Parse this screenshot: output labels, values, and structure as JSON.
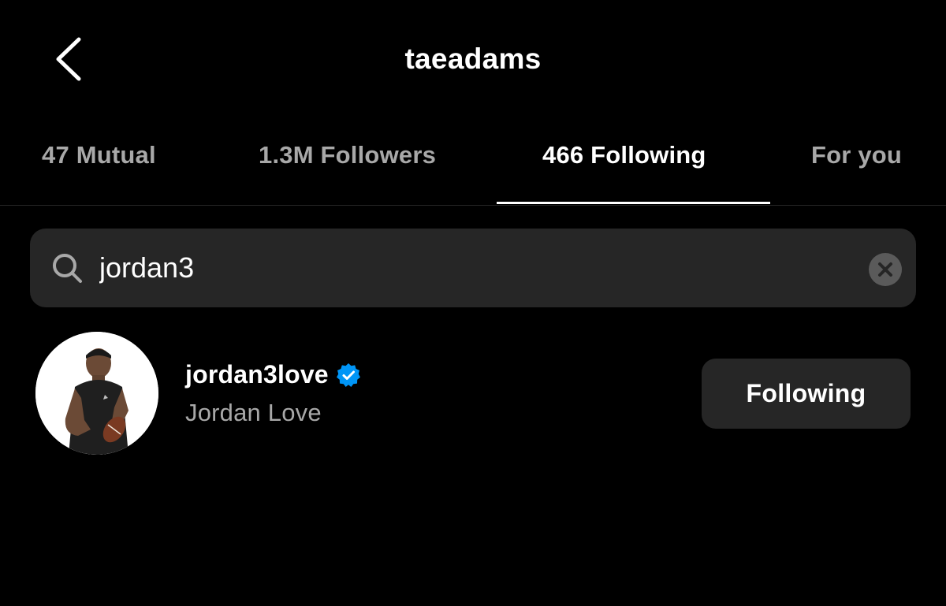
{
  "header": {
    "title": "taeadams",
    "back_icon": "chevron-left-icon"
  },
  "tabs": [
    {
      "label": "47 Mutual",
      "active": false
    },
    {
      "label": "1.3M Followers",
      "active": false
    },
    {
      "label": "466 Following",
      "active": true
    },
    {
      "label": "For you",
      "active": false
    }
  ],
  "search": {
    "value": "jordan3",
    "icon": "search-icon",
    "clear_icon": "clear-icon"
  },
  "results": [
    {
      "username": "jordan3love",
      "verified": true,
      "full_name": "Jordan Love",
      "button_label": "Following"
    }
  ],
  "colors": {
    "background": "#000000",
    "surface": "#262626",
    "text_primary": "#ffffff",
    "text_secondary": "#a8a8a8",
    "verified_blue": "#0095f6"
  }
}
